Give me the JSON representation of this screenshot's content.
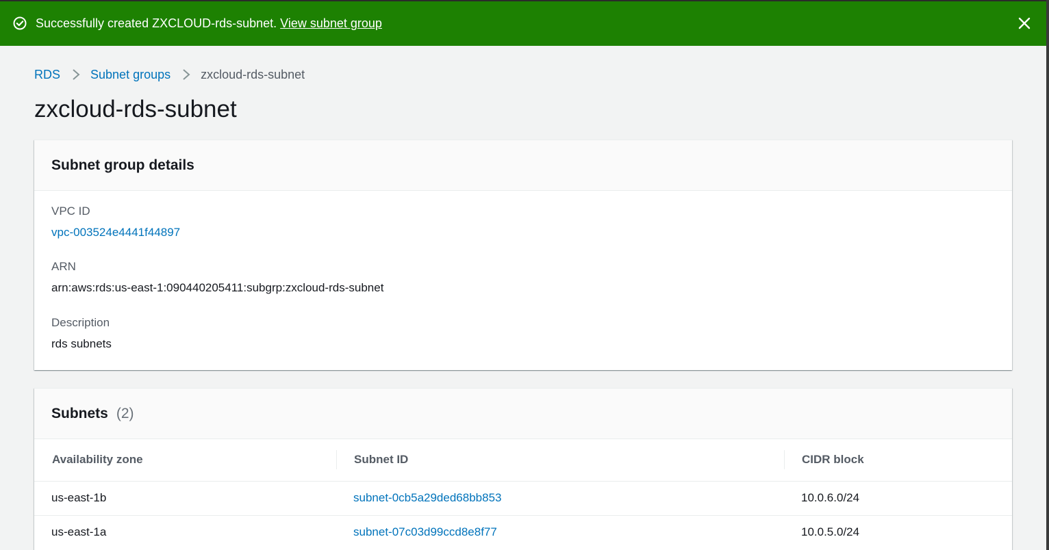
{
  "flash": {
    "message": "Successfully created ZXCLOUD-rds-subnet.",
    "link_label": "View subnet group",
    "color": "#1d8102",
    "icon": "check-circle-icon",
    "close_icon": "close-icon"
  },
  "breadcrumb": {
    "items": [
      "RDS",
      "Subnet groups"
    ],
    "current": "zxcloud-rds-subnet",
    "separator_icon": "chevron-right-icon"
  },
  "page_title": "zxcloud-rds-subnet",
  "details": {
    "title": "Subnet group details",
    "vpc_id_label": "VPC ID",
    "vpc_id_value": "vpc-003524e4441f44897",
    "arn_label": "ARN",
    "arn_value": "arn:aws:rds:us-east-1:090440205411:subgrp:zxcloud-rds-subnet",
    "description_label": "Description",
    "description_value": "rds subnets"
  },
  "subnets": {
    "title": "Subnets",
    "count": "(2)",
    "columns": [
      "Availability zone",
      "Subnet ID",
      "CIDR block"
    ],
    "rows": [
      {
        "az": "us-east-1b",
        "subnet_id": "subnet-0cb5a29ded68bb853",
        "cidr": "10.0.6.0/24"
      },
      {
        "az": "us-east-1a",
        "subnet_id": "subnet-07c03d99ccd8e8f77",
        "cidr": "10.0.5.0/24"
      }
    ]
  },
  "colors": {
    "link": "#0073bb",
    "success": "#1d8102",
    "background": "#f2f3f3"
  }
}
